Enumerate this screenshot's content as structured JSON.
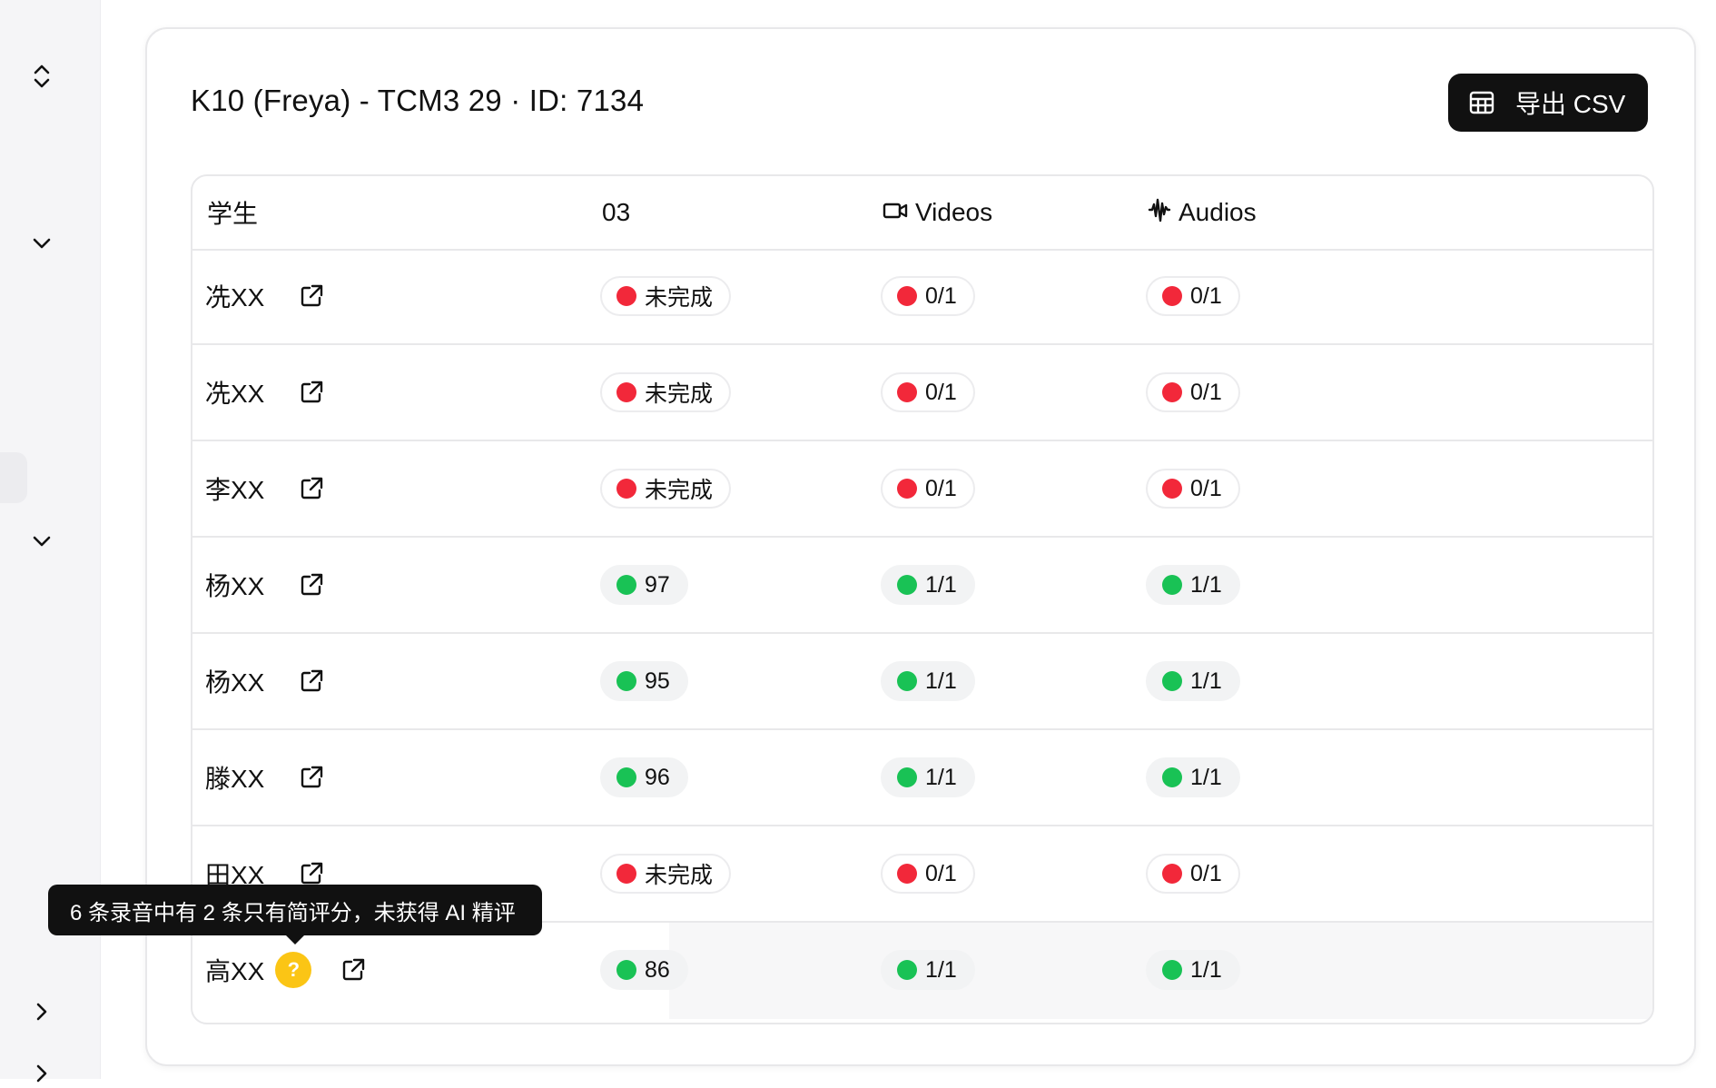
{
  "header": {
    "title": "K10 (Freya) - TCM3 29 · ID: 7134",
    "export_label": "导出 CSV"
  },
  "table": {
    "columns": {
      "student": "学生",
      "lesson": "03",
      "videos": "Videos",
      "audios": "Audios"
    },
    "rows": [
      {
        "name": "冼XX",
        "lesson": "未完成",
        "videos": "0/1",
        "audios": "0/1",
        "status": "incomplete"
      },
      {
        "name": "冼XX",
        "lesson": "未完成",
        "videos": "0/1",
        "audios": "0/1",
        "status": "incomplete"
      },
      {
        "name": "李XX",
        "lesson": "未完成",
        "videos": "0/1",
        "audios": "0/1",
        "status": "incomplete"
      },
      {
        "name": "杨XX",
        "lesson": "97",
        "videos": "1/1",
        "audios": "1/1",
        "status": "complete"
      },
      {
        "name": "杨XX",
        "lesson": "95",
        "videos": "1/1",
        "audios": "1/1",
        "status": "complete"
      },
      {
        "name": "滕XX",
        "lesson": "96",
        "videos": "1/1",
        "audios": "1/1",
        "status": "complete"
      },
      {
        "name": "田XX",
        "lesson": "未完成",
        "videos": "0/1",
        "audios": "0/1",
        "status": "incomplete"
      },
      {
        "name": "高XX",
        "lesson": "86",
        "videos": "1/1",
        "audios": "1/1",
        "status": "complete",
        "help": "?"
      }
    ]
  },
  "tooltip": {
    "text": "6 条录音中有 2 条只有简评分，未获得 AI 精评"
  },
  "colors": {
    "incomplete": "#f2283a",
    "complete": "#19c255",
    "help": "#fbc515",
    "dark": "#111111"
  },
  "icons": {
    "sidebar": [
      "chevron-up-down-icon",
      "chevron-down-icon",
      "chevron-down-icon",
      "chevron-right-icon",
      "chevron-right-icon"
    ],
    "export": "table-grid-icon",
    "videos": "video-camera-icon",
    "audios": "audio-wave-icon",
    "row": "external-link-icon"
  }
}
